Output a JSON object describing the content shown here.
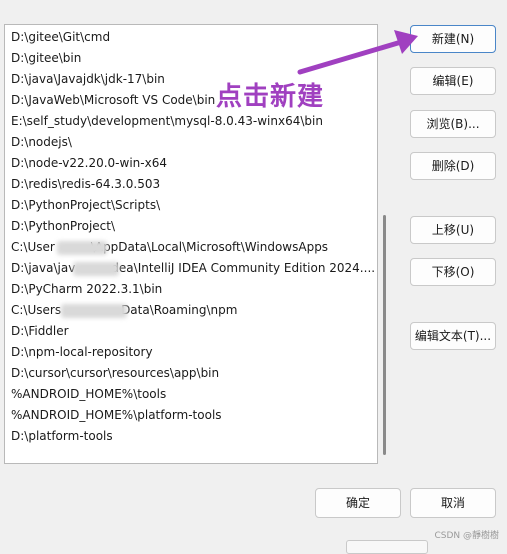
{
  "paths": [
    "D:\\gitee\\Git\\cmd",
    "D:\\gitee\\bin",
    "D:\\java\\Javajdk\\jdk-17\\bin",
    "D:\\JavaWeb\\Microsoft VS Code\\bin",
    "E:\\self_study\\development\\mysql-8.0.43-winx64\\bin",
    "D:\\nodejs\\",
    "D:\\node-v22.20.0-win-x64",
    "D:\\redis\\redis-64.3.0.503",
    "D:\\PythonProject\\Scripts\\",
    "D:\\PythonProject\\",
    "C:\\User   \\AppData\\Local\\Microsoft\\WindowsApps",
    "D:\\java\\jav   dea\\IntelliJ IDEA Community Edition 2024....",
    "D:\\PyCharm 2022.3.1\\bin",
    "C:\\Users     Data\\Roaming\\npm",
    "D:\\Fiddler",
    "D:\\npm-local-repository",
    "D:\\cursor\\cursor\\resources\\app\\bin",
    "%ANDROID_HOME%\\tools",
    "%ANDROID_HOME%\\platform-tools",
    "D:\\platform-tools"
  ],
  "buttons": {
    "new": "新建(N)",
    "edit": "编辑(E)",
    "browse": "浏览(B)...",
    "delete": "删除(D)",
    "move_up": "上移(U)",
    "move_down": "下移(O)",
    "edit_text": "编辑文本(T)...",
    "ok": "确定",
    "cancel": "取消"
  },
  "annotation": {
    "text": "点击新建",
    "color": "#a040c0"
  },
  "watermark": "CSDN @靜樹樹"
}
